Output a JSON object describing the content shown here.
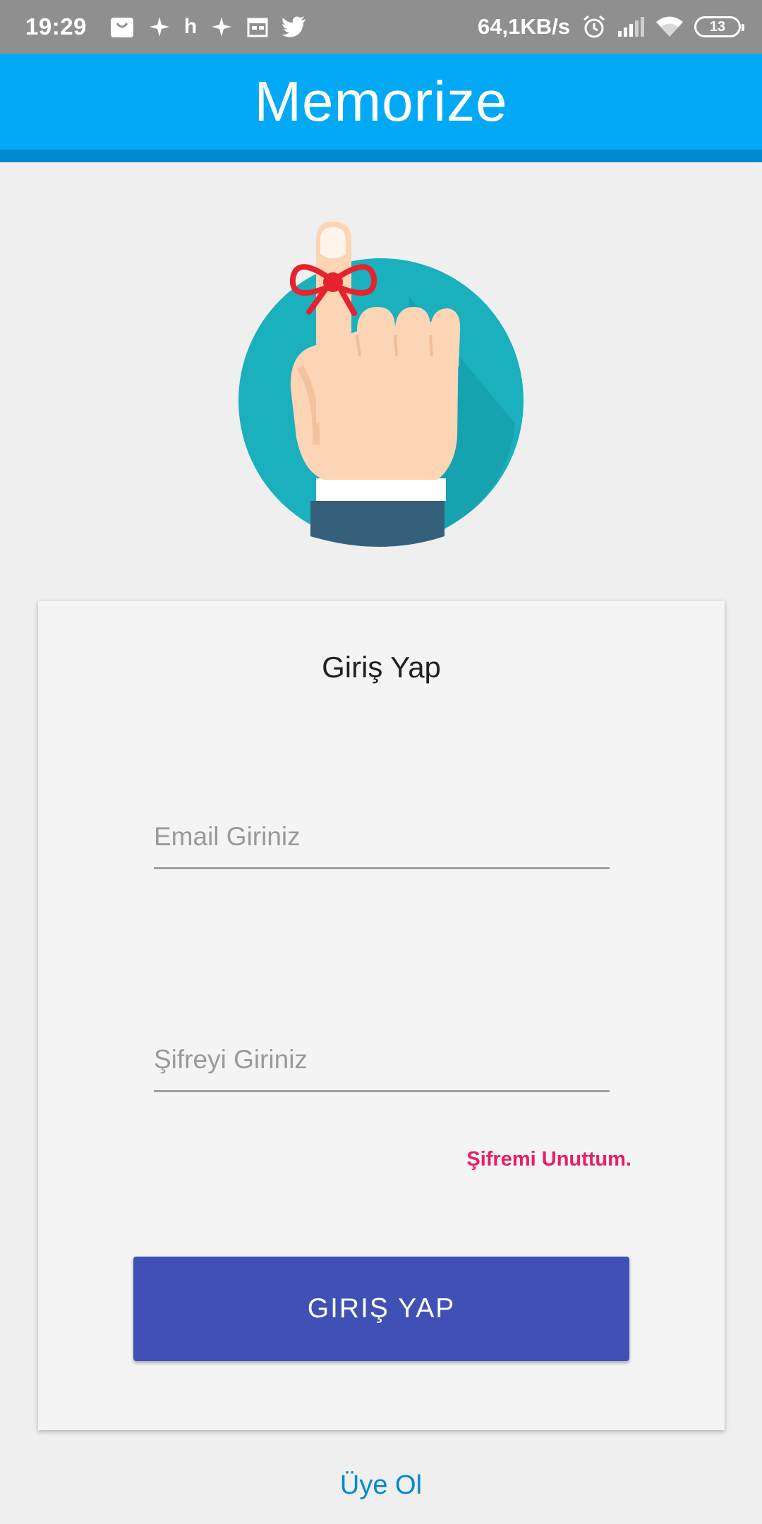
{
  "status_bar": {
    "time": "19:29",
    "left_icons": [
      "shopping-bag-icon",
      "pinwheel-icon",
      "h-icon",
      "pinwheel-icon",
      "calendar-icon",
      "twitter-icon"
    ],
    "h_glyph": "h",
    "network_speed": "64,1KB/s",
    "right_icons": [
      "alarm-icon",
      "cellular-signal-icon",
      "wifi-icon",
      "battery-icon"
    ],
    "battery_level": "13"
  },
  "app_bar": {
    "title": "Memorize",
    "color": "#03a9f4",
    "strip_color": "#0288d1"
  },
  "logo": {
    "icon": "finger-with-ribbon-icon",
    "circle_color": "#1ab0be",
    "ribbon_color": "#e52330"
  },
  "login_card": {
    "title": "Giriş Yap",
    "email": {
      "placeholder": "Email Giriniz",
      "value": ""
    },
    "password": {
      "placeholder": "Şifreyi Giriniz",
      "value": ""
    },
    "forgot_password_label": "Şifremi Unuttum.",
    "forgot_color": "#e91e63",
    "login_button_label": "GIRIŞ YAP",
    "button_color": "#3f51b5"
  },
  "signup_link": {
    "label": "Üye Ol",
    "color": "#0288d1"
  }
}
